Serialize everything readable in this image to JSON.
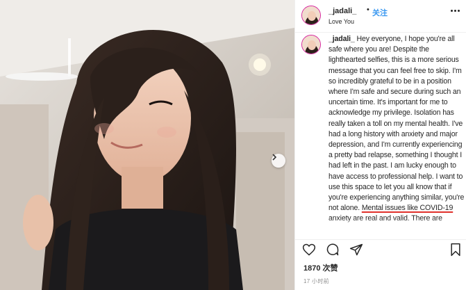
{
  "post": {
    "username": "_jadali_",
    "separator": "•",
    "follow_label": "关注",
    "location": "Love You"
  },
  "caption": {
    "username": "_jadali_",
    "text_before": " Hey everyone, I hope you're all safe where you are! Despite the lighthearted selfies, this is a more serious message that you can feel free to skip. I'm so incredibly grateful to be in a position where I'm safe and secure during such an uncertain time. It's important for me to acknowledge my privilege. Isolation has really taken a toll on my mental health. I've had a long history with anxiety and major depression, and I'm currently experiencing a pretty bad relapse, something I thought I had left in the past. I am lucky enough to have access to professional help. I want to use this space to let you all know that if you're experiencing anything similar, you're not alone. ",
    "highlighted": "Mental issues like COVID-19",
    "text_after": " anxiety are real and valid. There are people who are still here for you and will support you."
  },
  "stats": {
    "likes": "1870 次赞",
    "time": "17 小时前"
  },
  "icons": {
    "like": "heart-icon",
    "comment": "comment-icon",
    "share": "share-icon",
    "save": "bookmark-icon",
    "more": "more-icon",
    "next": "chevron-right-icon"
  },
  "colors": {
    "accent": "#3897f0",
    "highlight_underline": "#e0302b",
    "text": "#262626"
  }
}
